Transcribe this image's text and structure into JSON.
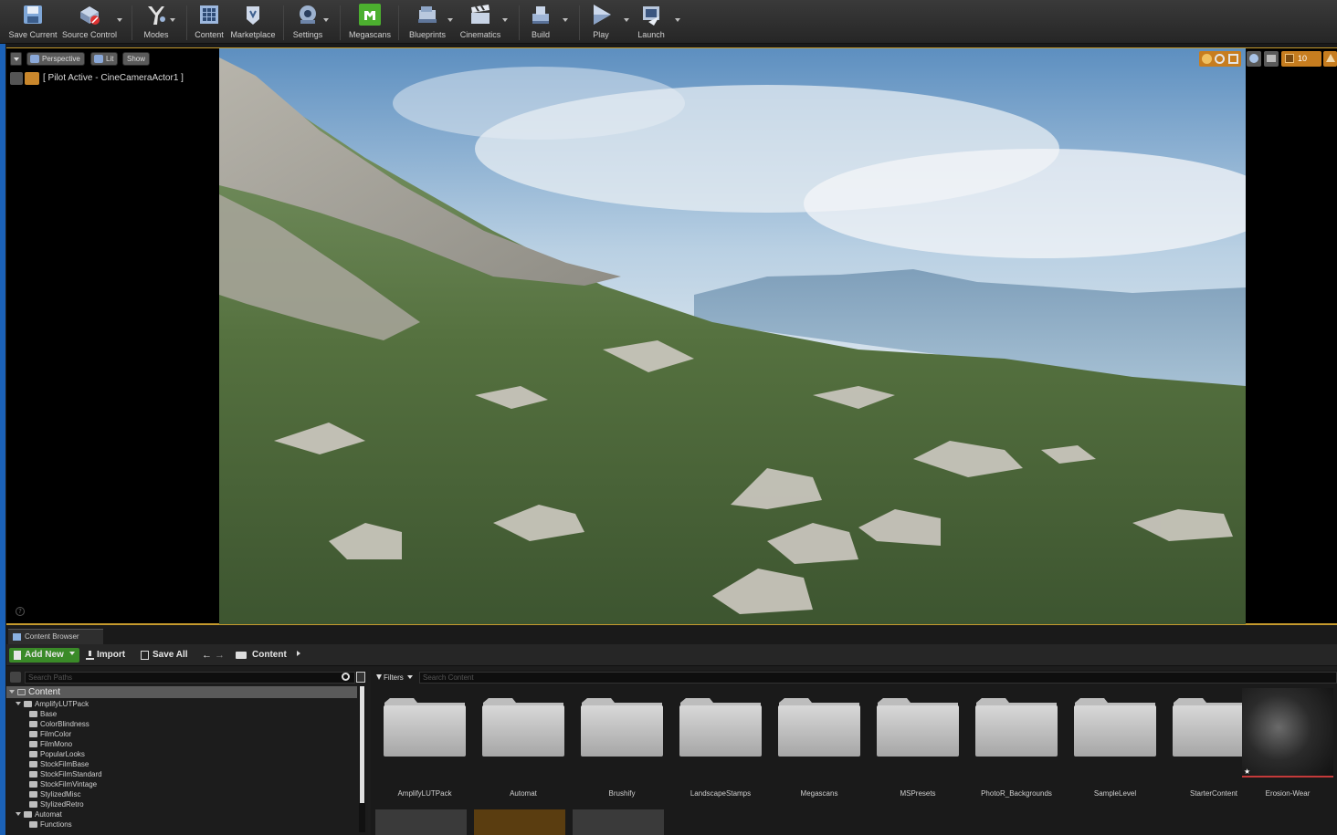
{
  "toolbar": {
    "items": [
      {
        "label": "Save Current",
        "icon": "save-icon"
      },
      {
        "label": "Source Control",
        "icon": "source-control-icon"
      },
      {
        "label": "Modes",
        "icon": "modes-icon"
      },
      {
        "label": "Content",
        "icon": "content-icon"
      },
      {
        "label": "Marketplace",
        "icon": "marketplace-icon"
      },
      {
        "label": "Settings",
        "icon": "settings-icon"
      },
      {
        "label": "Megascans",
        "icon": "megascans-icon"
      },
      {
        "label": "Blueprints",
        "icon": "blueprints-icon"
      },
      {
        "label": "Cinematics",
        "icon": "cinematics-icon"
      },
      {
        "label": "Build",
        "icon": "build-icon"
      },
      {
        "label": "Play",
        "icon": "play-icon"
      },
      {
        "label": "Launch",
        "icon": "launch-icon"
      }
    ]
  },
  "viewport": {
    "perspective": "Perspective",
    "lit": "Lit",
    "show": "Show",
    "pilot": "[ Pilot Active - CineCameraActor1 ]",
    "snap_value": "10"
  },
  "content_browser": {
    "tab": "Content Browser",
    "add_new": "Add New",
    "import": "Import",
    "save_all": "Save All",
    "breadcrumb": "Content",
    "search_paths_placeholder": "Search Paths",
    "filters": "Filters",
    "search_content_placeholder": "Search Content",
    "tree": [
      {
        "label": "Content",
        "level": 0,
        "expanded": true
      },
      {
        "label": "AmplifyLUTPack",
        "level": 1,
        "expanded": true
      },
      {
        "label": "Base",
        "level": 2
      },
      {
        "label": "ColorBlindness",
        "level": 2
      },
      {
        "label": "FilmColor",
        "level": 2
      },
      {
        "label": "FilmMono",
        "level": 2
      },
      {
        "label": "PopularLooks",
        "level": 2
      },
      {
        "label": "StockFilmBase",
        "level": 2
      },
      {
        "label": "StockFilmStandard",
        "level": 2
      },
      {
        "label": "StockFilmVintage",
        "level": 2
      },
      {
        "label": "StylizedMisc",
        "level": 2
      },
      {
        "label": "StylizedRetro",
        "level": 2
      },
      {
        "label": "Automat",
        "level": 1,
        "expanded": true
      },
      {
        "label": "Functions",
        "level": 2
      }
    ],
    "assets": [
      "AmplifyLUTPack",
      "Automat",
      "Brushify",
      "LandscapeStamps",
      "Megascans",
      "MSPresets",
      "PhotoR_Backgrounds",
      "SampleLevel",
      "StarterContent",
      "Erosion-Wear"
    ]
  },
  "colors": {
    "accent_blue": "#1b62b8",
    "viewport_border": "#c59a2d",
    "add_new_green": "#3a8a28",
    "megascans_green": "#4caf2f"
  }
}
